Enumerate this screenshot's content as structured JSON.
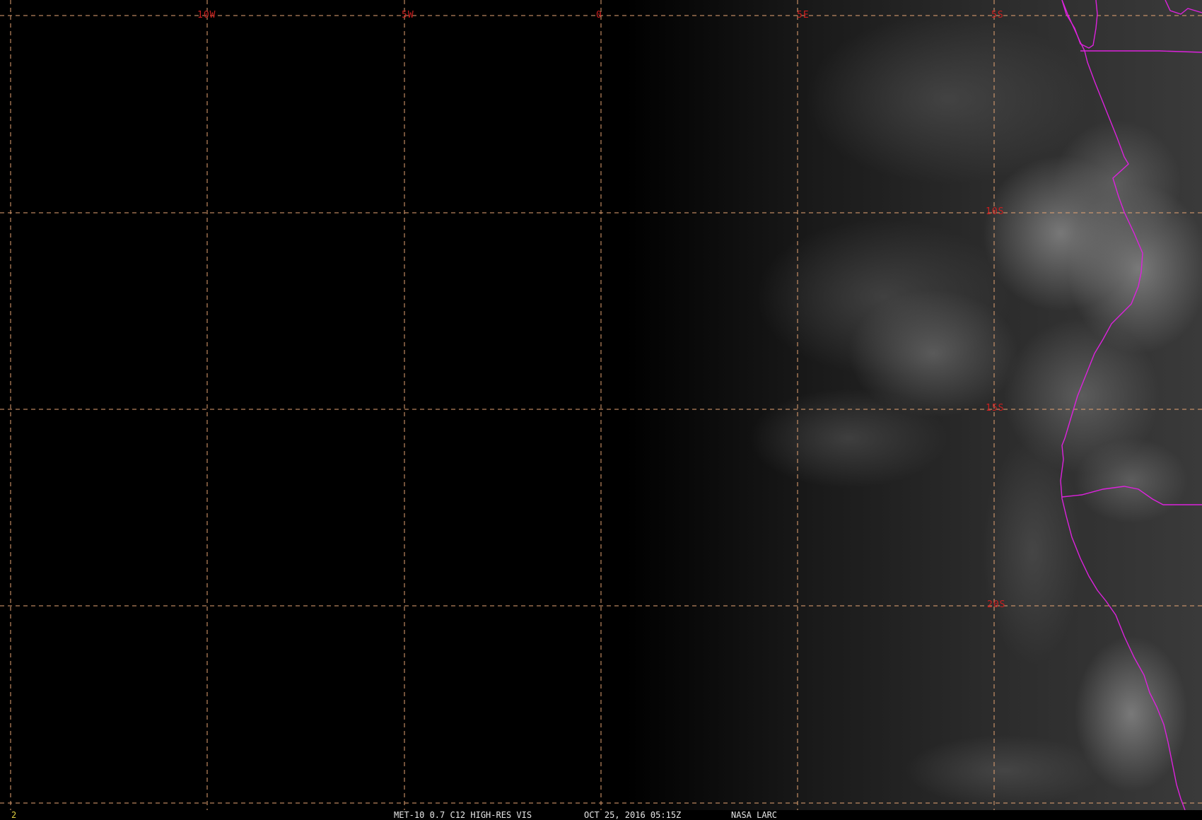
{
  "map": {
    "longitude_labels": [
      "10W",
      "5W",
      "0",
      "5E"
    ],
    "latitude_labels": [
      "5S",
      "10S",
      "15S",
      "20S"
    ],
    "grid": {
      "shown": true,
      "style": "dashed",
      "color": "#e6a473"
    },
    "label_color": "#cc1f1f",
    "coastline_color": "#dd22dd",
    "frame_number": "2",
    "frame_number_color": "#e0d040"
  },
  "status": {
    "product": "MET-10 0.7 C12 HIGH-RES VIS",
    "timestamp": "OCT 25, 2016 05:15Z",
    "source": "NASA LARC"
  }
}
